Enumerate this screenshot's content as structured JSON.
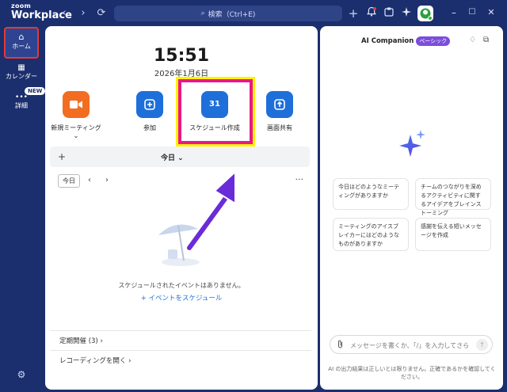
{
  "app": {
    "logo_small": "zoom",
    "logo_big": "Workplace"
  },
  "titlebar": {
    "back_glyph": "‹",
    "forward_glyph": "›",
    "history_glyph": "⟳",
    "search_icon": "⌕",
    "search_label": "検索（Ctrl+E)",
    "add_glyph": "+",
    "minimize_glyph": "–",
    "maximize_glyph": "☐",
    "close_glyph": "✕"
  },
  "nav": {
    "home_label": "ホーム",
    "home_icon": "⌂",
    "calendar_label": "カレンダー",
    "calendar_icon": "▦",
    "more_label": "詳細",
    "more_icon": "•••",
    "new_badge": "NEW",
    "settings_icon": "⚙"
  },
  "main": {
    "time": "15:51",
    "date": "2026年1月6日",
    "actions": [
      {
        "label": "新規ミーティング ⌄",
        "icon": "videocam",
        "glyph": "■"
      },
      {
        "label": "参加",
        "icon": "plus",
        "glyph": "+"
      },
      {
        "label": "スケジュール作成",
        "icon": "calendar",
        "glyph": "31"
      },
      {
        "label": "画面共有",
        "icon": "share-up-arrow",
        "glyph": "↑"
      }
    ],
    "calendar": {
      "add_glyph": "+",
      "title": "今日 ⌄",
      "today_button": "今日",
      "prev": "‹",
      "next": "›",
      "more": "···"
    },
    "empty_message": "スケジュールされたイベントはありません。",
    "add_event": "+ イベントをスケジュール",
    "rows": [
      "定期開催 (3)  ›",
      "レコーディングを開く  ›"
    ]
  },
  "panel": {
    "title": "AI Companion",
    "tier": "ベーシック",
    "suggestions": [
      "今日はどのようなミーティングがありますか",
      "チームのつながりを深めるアクティビティに関するアイデアをブレインストーミング",
      "ミーティングのアイスブレイカーにはどのようなものがありますか",
      "感謝を伝える短いメッセージを作成"
    ],
    "composer_placeholder": "メッセージを書くか、「/」を入力してさらに…",
    "send_glyph": "↑",
    "bell_glyph": "♢",
    "popout_glyph": "⧉",
    "disclaimer": "AI の出力結果は正しいとは限りません。正確であるかを確認してください。"
  },
  "colors": {
    "frame": "#1b2e6e",
    "accent": "#1e6fd9",
    "new_meeting": "#f26d21",
    "highlight_border": "#e9178a",
    "highlight_outline": "#fff200",
    "annotation_arrow": "#6a2bd8"
  }
}
